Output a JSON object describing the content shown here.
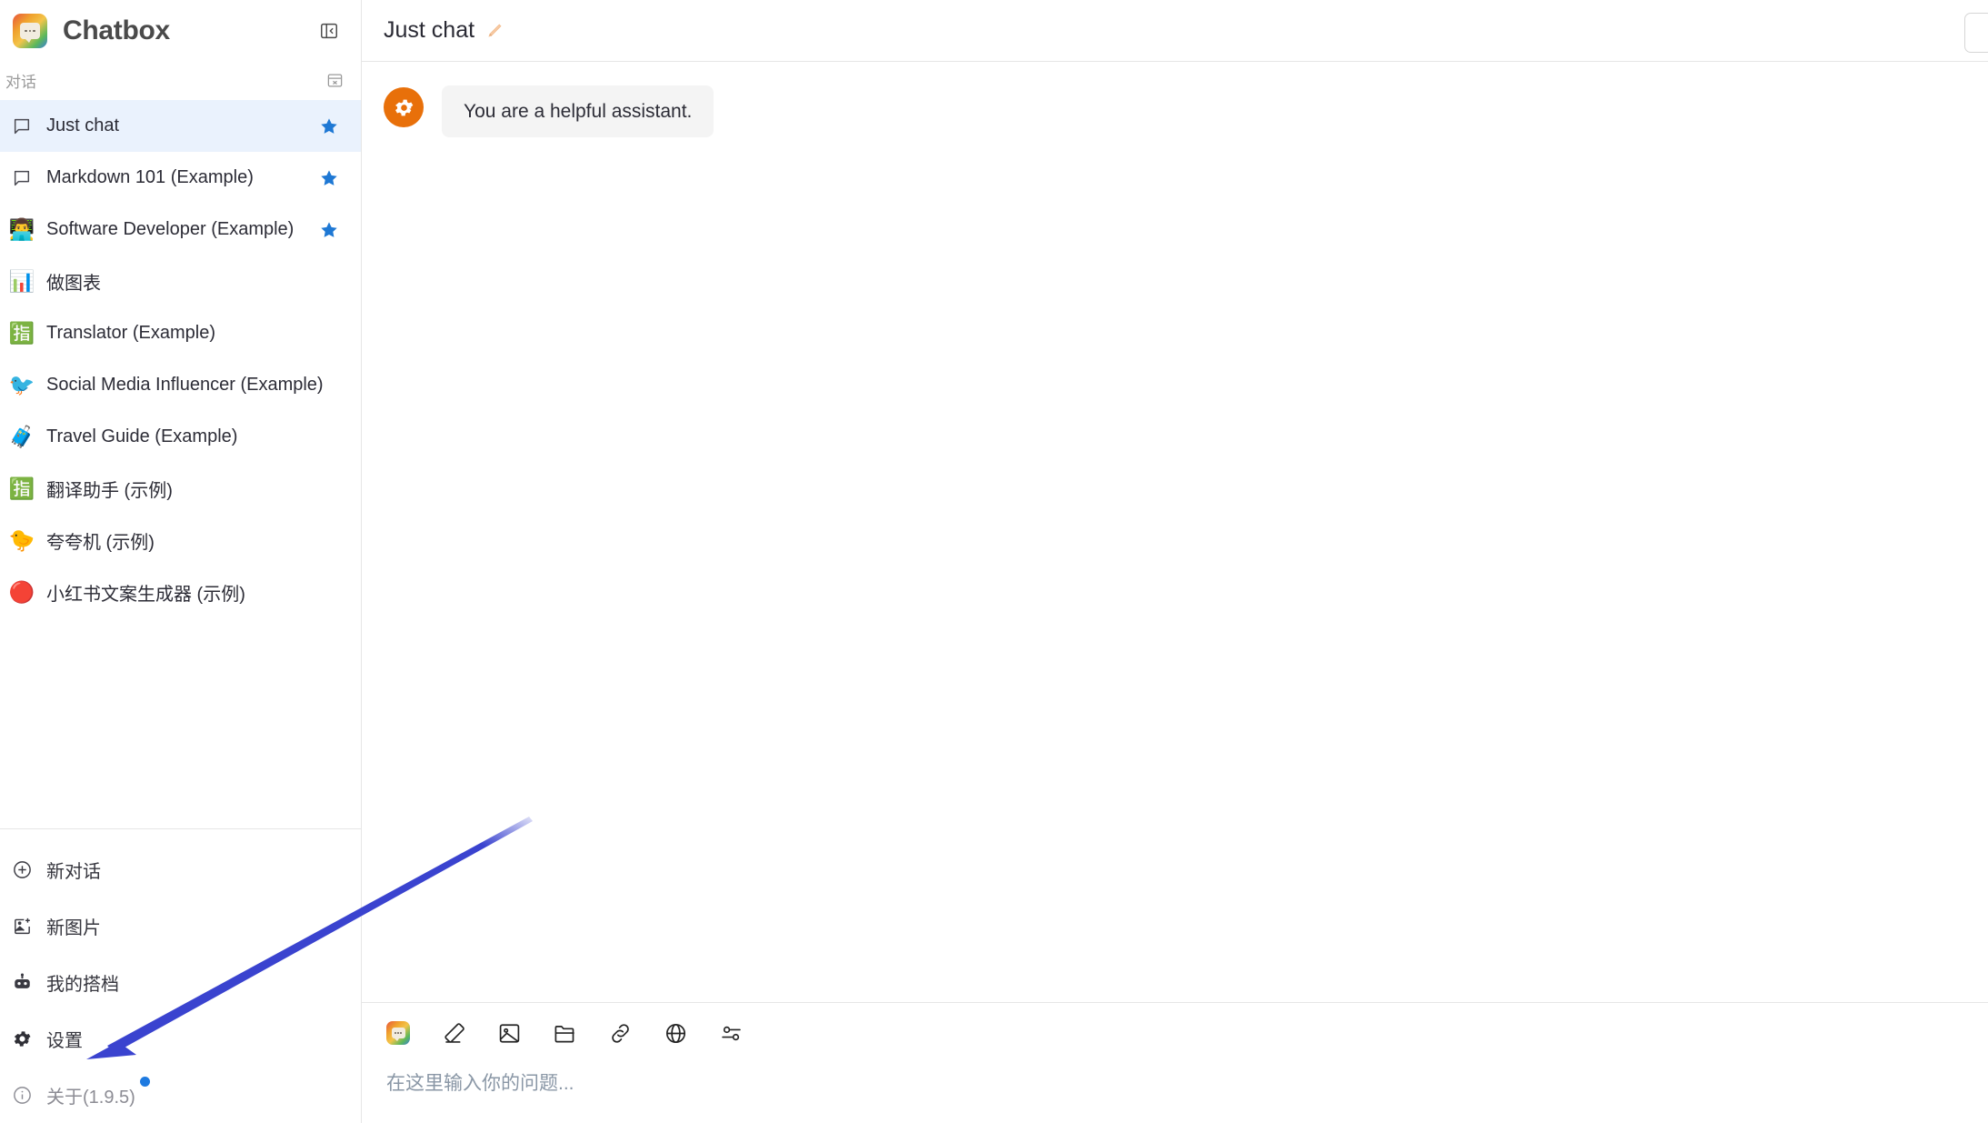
{
  "app": {
    "brand": "Chatbox",
    "logo_icon": "chatbox-logo-icon",
    "collapse_icon": "panel-collapse-icon"
  },
  "sidebar": {
    "section_title": "对话",
    "archive_icon": "archive-icon",
    "conversations": [
      {
        "label": "Just chat",
        "icon": "chat-bubble-icon",
        "icon_type": "svg",
        "starred": true,
        "selected": true
      },
      {
        "label": "Markdown 101 (Example)",
        "icon": "chat-bubble-icon",
        "icon_type": "svg",
        "starred": true,
        "selected": false
      },
      {
        "label": "Software Developer (Example)",
        "icon": "👨‍💻",
        "icon_type": "emoji",
        "starred": true,
        "selected": false
      },
      {
        "label": "做图表",
        "icon": "📊",
        "icon_type": "emoji",
        "starred": false,
        "selected": false
      },
      {
        "label": "Translator (Example)",
        "icon": "🈯",
        "icon_type": "emoji",
        "starred": false,
        "selected": false
      },
      {
        "label": "Social Media Influencer (Example)",
        "icon": "🐦",
        "icon_type": "emoji",
        "starred": false,
        "selected": false
      },
      {
        "label": "Travel Guide (Example)",
        "icon": "🧳",
        "icon_type": "emoji",
        "starred": false,
        "selected": false
      },
      {
        "label": "翻译助手 (示例)",
        "icon": "🈯",
        "icon_type": "emoji",
        "starred": false,
        "selected": false
      },
      {
        "label": "夸夸机 (示例)",
        "icon": "🐤",
        "icon_type": "emoji",
        "starred": false,
        "selected": false
      },
      {
        "label": "小红书文案生成器 (示例)",
        "icon": "🔴",
        "icon_type": "emoji",
        "starred": false,
        "selected": false
      }
    ],
    "nav": [
      {
        "label": "新对话",
        "icon": "plus-circle-icon"
      },
      {
        "label": "新图片",
        "icon": "image-plus-icon"
      },
      {
        "label": "我的搭档",
        "icon": "robot-icon"
      },
      {
        "label": "设置",
        "icon": "gear-icon"
      },
      {
        "label": "关于(1.9.5)",
        "icon": "info-circle-icon",
        "badge": true,
        "muted": true
      }
    ]
  },
  "main": {
    "chat_title": "Just chat",
    "edit_icon": "pencil-icon",
    "messages": [
      {
        "role": "system",
        "avatar_icon": "gear-icon",
        "text": "You are a helpful assistant."
      }
    ],
    "composer": {
      "placeholder": "在这里输入你的问题...",
      "tools": [
        {
          "name": "chatbox-logo-icon"
        },
        {
          "name": "eraser-icon"
        },
        {
          "name": "image-icon"
        },
        {
          "name": "folder-icon"
        },
        {
          "name": "link-icon"
        },
        {
          "name": "globe-icon"
        },
        {
          "name": "sliders-icon"
        }
      ]
    }
  },
  "annotation": {
    "arrow_color": "#3a43cf",
    "points_to": "设置"
  },
  "colors": {
    "accent_blue": "#1e7ae0",
    "star_blue": "#1e78d4",
    "selected_bg": "#eaf2fd",
    "avatar_orange": "#e8700a",
    "bubble_bg": "#f4f4f4"
  }
}
